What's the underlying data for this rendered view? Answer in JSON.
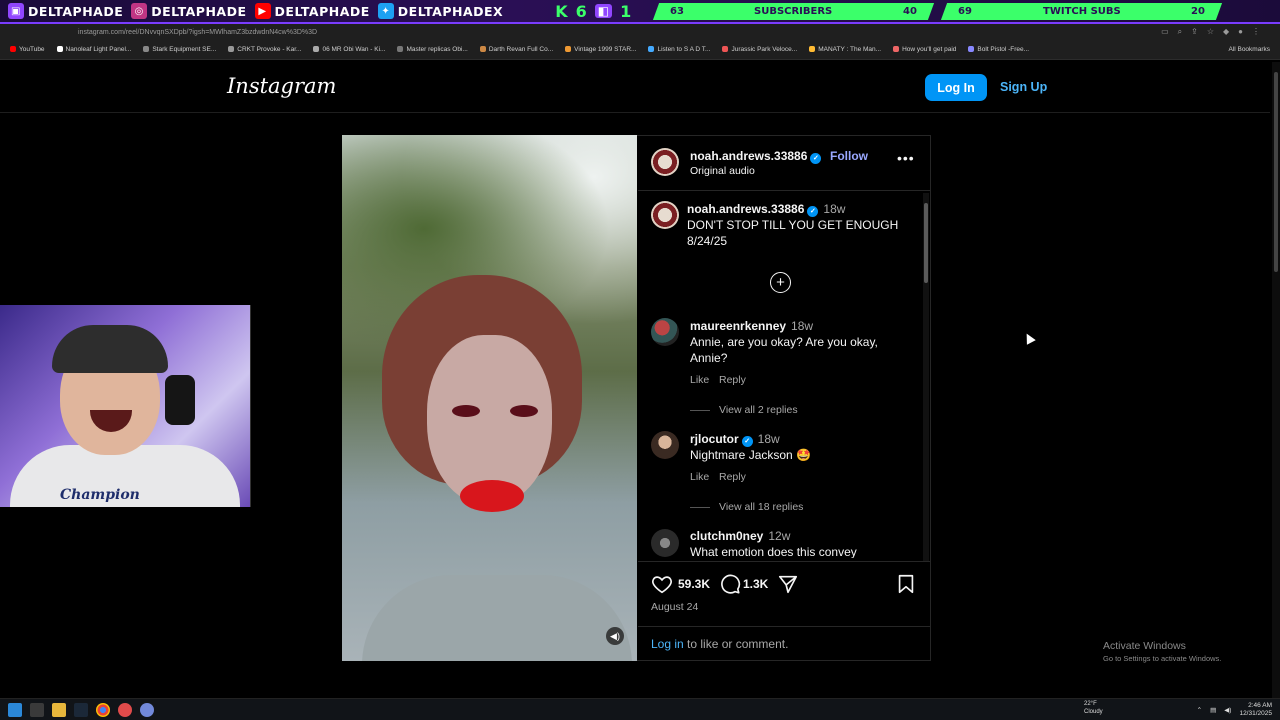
{
  "overlay": {
    "handles": [
      "DELTAPHADE",
      "DELTAPHADE",
      "DELTAPHADE",
      "DELTAPHADEX"
    ],
    "counter_k": "K",
    "counter_6": "6",
    "counter_1": "1",
    "subs_current": "63",
    "subs_label": "SUBSCRIBERS",
    "subs_goal": "40",
    "twitch_current": "69",
    "twitch_label": "TWITCH SUBS",
    "twitch_goal": "20"
  },
  "browser": {
    "url": "instagram.com/reel/DNvvqnSXDpb/?igsh=MWlhamZ3bzdwdnN4cw%3D%3D",
    "bookmarks": [
      "YouTube",
      "Nanoleaf Light Panel...",
      "Stark Equipment SE...",
      "CRKT Provoke - Kar...",
      "06 MR Obi Wan - Ki...",
      "Master replicas Obi...",
      "Darth Revan Full Co...",
      "Vintage 1999 STAR...",
      "Listen to S A D T...",
      "Jurassic Park Veloce...",
      "MANATY : The Man...",
      "How you'll get paid",
      "Bolt Pistol -Free..."
    ],
    "all_bookmarks": "All Bookmarks"
  },
  "instagram": {
    "logo": "Instagram",
    "login": "Log In",
    "signup": "Sign Up"
  },
  "post": {
    "author": "noah.andrews.33886",
    "follow": "Follow",
    "audio": "Original audio",
    "caption_time": "18w",
    "caption_line1": "DON'T STOP TILL YOU GET ENOUGH",
    "caption_line2": "8/24/25",
    "likes": "59.3K",
    "comments_count": "1.3K",
    "date": "August 24",
    "login_link": "Log in",
    "login_rest": " to like or comment."
  },
  "comments": [
    {
      "user": "maureenrkenney",
      "time": "18w",
      "text": "Annie, are you okay? Are you okay, Annie?",
      "like": "Like",
      "reply": "Reply",
      "view": "View all 2 replies"
    },
    {
      "user": "rjlocutor",
      "time": "18w",
      "text": "Nightmare Jackson 🤩",
      "like": "Like",
      "reply": "Reply",
      "view": "View all 18 replies"
    },
    {
      "user": "clutchm0ney",
      "time": "12w",
      "text": "What emotion does this convey"
    }
  ],
  "webcam": {
    "brand": "Champion"
  },
  "windows": {
    "activate_title": "Activate Windows",
    "activate_sub": "Go to Settings to activate Windows.",
    "weather_temp": "22°F",
    "weather_desc": "Cloudy",
    "time": "2:46 AM",
    "date": "12/31/2025"
  },
  "colors": {
    "accent": "#0095f6",
    "overlay_green": "#3bff6a",
    "overlay_purple": "#2a0f55"
  }
}
